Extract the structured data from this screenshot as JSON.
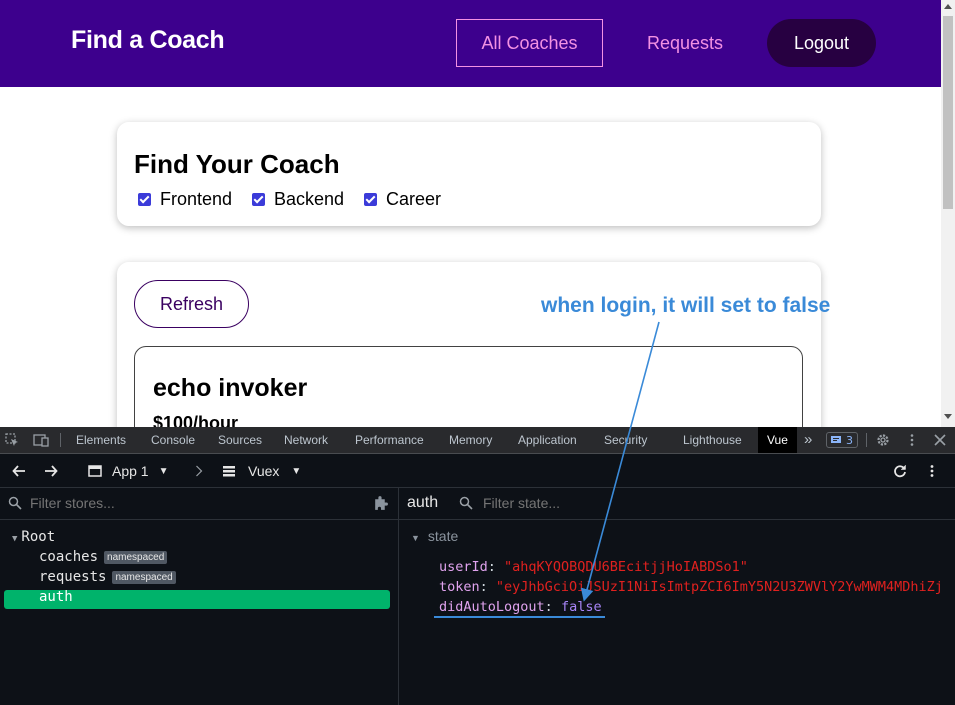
{
  "app": {
    "brand": "Find a Coach",
    "nav": {
      "all_coaches": "All Coaches",
      "requests": "Requests",
      "logout": "Logout"
    }
  },
  "filter": {
    "title": "Find Your Coach",
    "options": [
      {
        "label": "Frontend",
        "checked": true
      },
      {
        "label": "Backend",
        "checked": true
      },
      {
        "label": "Career",
        "checked": true
      }
    ]
  },
  "coaches": {
    "refresh_label": "Refresh",
    "items": [
      {
        "name": "echo invoker",
        "rate": "$100/hour"
      }
    ]
  },
  "devtools": {
    "tabs": [
      "Elements",
      "Console",
      "Sources",
      "Network",
      "Performance",
      "Memory",
      "Application",
      "Security",
      "Lighthouse",
      "Vue"
    ],
    "active_tab": "Vue",
    "message_count": "3",
    "vue": {
      "app_label": "App 1",
      "plugin_label": "Vuex",
      "filter_stores_placeholder": "Filter stores...",
      "store_title": "auth",
      "filter_state_placeholder": "Filter state...",
      "tree": {
        "root": "Root",
        "modules": [
          {
            "name": "coaches",
            "badge": "namespaced"
          },
          {
            "name": "requests",
            "badge": "namespaced"
          },
          {
            "name": "auth",
            "badge": ""
          }
        ],
        "selected": "auth"
      },
      "state": {
        "section_label": "state",
        "entries": [
          {
            "key": "userId",
            "value": "\"ahqKYQOBQDU6BEcitjjHoIABDSo1\""
          },
          {
            "key": "token",
            "value": "\"eyJhbGciOiJSUzI1NiIsImtpZCI6ImY5N2U3ZWVlY2YwMWM4MDhiZj"
          },
          {
            "key": "didAutoLogout",
            "value": "false"
          }
        ]
      }
    }
  },
  "annotation": {
    "text": "when login, it will set to false",
    "color": "#3a8ad8"
  }
}
